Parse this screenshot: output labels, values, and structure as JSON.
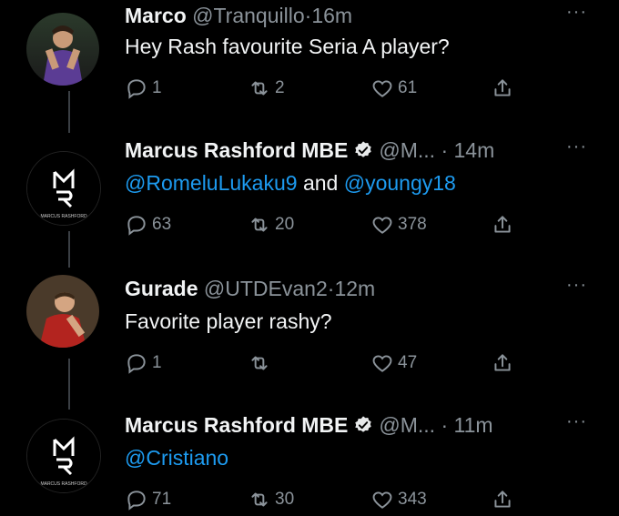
{
  "tweets": [
    {
      "name": "Marco",
      "handle": "@Tranquillo",
      "sep": "·",
      "time": "16m",
      "text": "Hey Rash favourite Seria A player?",
      "replies": "1",
      "retweets": "2",
      "likes": "61",
      "avatar_colors": [
        "#3b2a6b",
        "#5a3f8e"
      ],
      "verified": false
    },
    {
      "name": "Marcus Rashford MBE",
      "handle": "@M...",
      "sep": "·",
      "time": "14m",
      "mentions": [
        "@RomeluLukaku9",
        "@youngy18"
      ],
      "joiner": "and",
      "replies": "63",
      "retweets": "20",
      "likes": "378",
      "avatar_text": "MARCUS RASHFORD",
      "verified": true
    },
    {
      "name": "Gurade",
      "handle": "@UTDEvan2",
      "sep": "·",
      "time": "12m",
      "text": "Favorite player rashy?",
      "replies": "1",
      "retweets": "",
      "likes": "47",
      "avatar_colors": [
        "#8e1b1b",
        "#c0392b"
      ],
      "verified": false
    },
    {
      "name": "Marcus Rashford MBE",
      "handle": "@M...",
      "sep": "·",
      "time": "11m",
      "mentions": [
        "@Cristiano"
      ],
      "replies": "71",
      "retweets": "30",
      "likes": "343",
      "avatar_text": "MARCUS RASHFORD",
      "verified": true
    }
  ],
  "more_glyph": "···",
  "colors": {
    "background": "#000000",
    "link": "#1d9bf0",
    "muted": "#8b939a"
  }
}
